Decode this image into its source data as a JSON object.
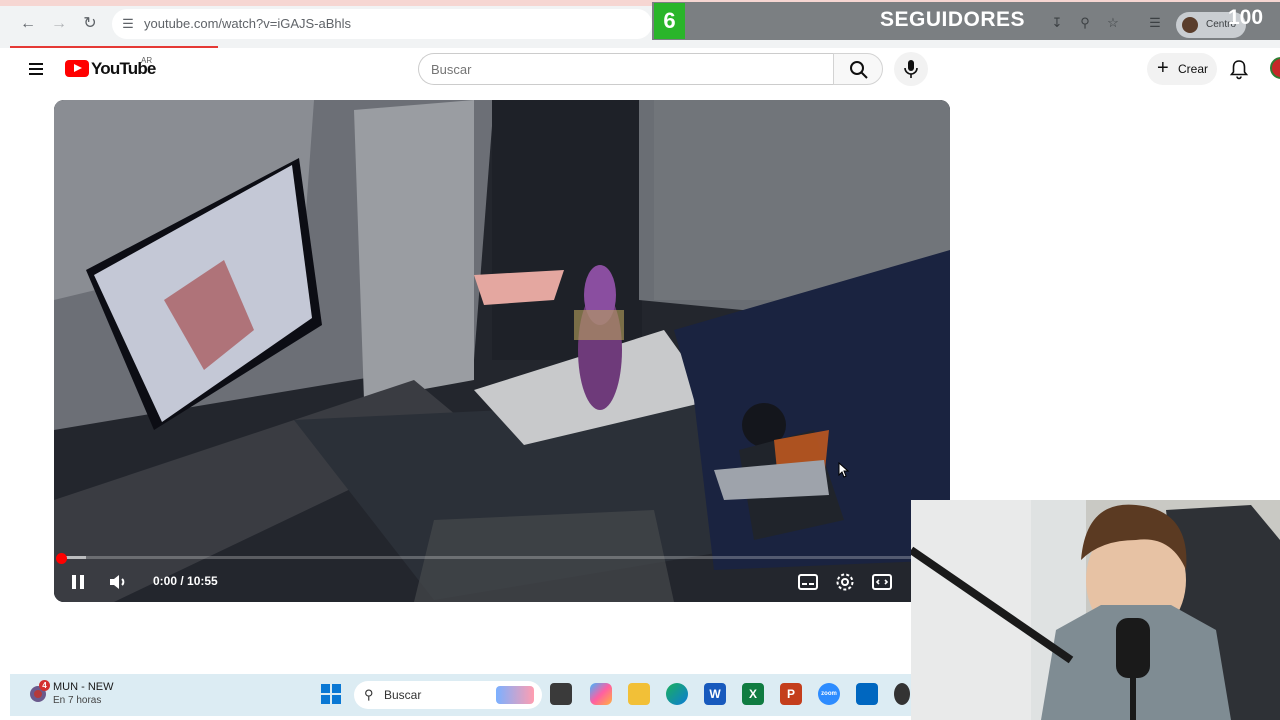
{
  "browser": {
    "url": "youtube.com/watch?v=iGAJS-aBhls",
    "profile_name": "Centro"
  },
  "overlay": {
    "follower_count": "6",
    "label": "SEGUIDORES",
    "goal": "100",
    "count_color": "#2ab52a"
  },
  "youtube": {
    "logo_text": "YouTube",
    "country_code": "AR",
    "search_placeholder": "Buscar",
    "create_label": "Crear",
    "brand_color": "#ff0000"
  },
  "player": {
    "time_display": "0:00 / 10:55",
    "progress_percent": 0
  },
  "taskbar": {
    "notification_badge": "4",
    "weather_title": "MUN - NEW",
    "weather_subtitle": "En 7 horas",
    "search_label": "Buscar",
    "apps": [
      "file-explorer-icon",
      "copilot-icon",
      "folder-icon",
      "edge-icon",
      "word-icon",
      "excel-icon",
      "powerpoint-icon",
      "zoom-icon",
      "store-icon",
      "app-icon"
    ]
  }
}
